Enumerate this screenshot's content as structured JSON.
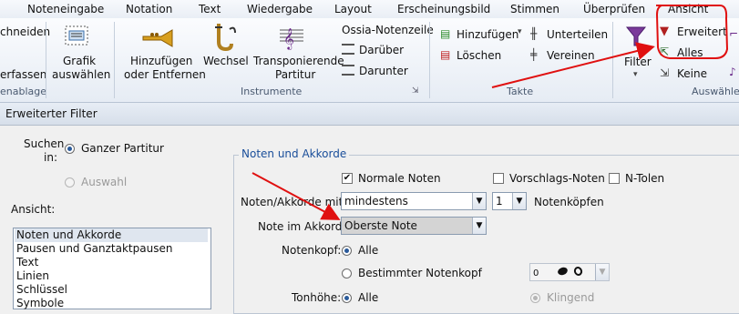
{
  "tabs": [
    "Noteneingabe",
    "Notation",
    "Text",
    "Wiedergabe",
    "Layout",
    "Erscheinungsbild",
    "Stimmen",
    "Überprüfen",
    "Ansicht"
  ],
  "ribbon": {
    "clipboard": {
      "item1": "chneiden",
      "item2": "erfassen",
      "group": "enablage"
    },
    "grafik": {
      "line1": "Grafik",
      "line2": "auswählen"
    },
    "instrumente": {
      "add_line1": "Hinzufügen",
      "add_line2": "oder Entfernen",
      "wechsel": "Wechsel",
      "transp_line1": "Transponierende",
      "transp_line2": "Partitur",
      "ossia": "Ossia-Notenzeile",
      "darueber": "Darüber",
      "darunter": "Darunter",
      "group": "Instrumente"
    },
    "takte": {
      "hinzufuegen": "Hinzufügen",
      "unterteilen": "Unterteilen",
      "loeschen": "Löschen",
      "vereinen": "Vereinen",
      "group": "Takte"
    },
    "filter": {
      "label": "Filter",
      "erweitert": "Erweitert",
      "alles": "Alles",
      "keine": "Keine",
      "group": "Auswähle"
    }
  },
  "dialog": {
    "title": "Erweiterter Filter",
    "suchen_label_1": "Suchen",
    "suchen_label_2": "in:",
    "opt_ganzer": "Ganzer Partitur",
    "opt_auswahl": "Auswahl",
    "ansicht_label": "Ansicht:",
    "list_items": [
      "Noten und Akkorde",
      "Pausen und Ganztaktpausen",
      "Text",
      "Linien",
      "Schlüssel",
      "Symbole"
    ],
    "section_title": "Noten und Akkorde",
    "chk_normale": "Normale Noten",
    "chk_vorschlag": "Vorschlags-Noten",
    "chk_ntolen": "N-Tolen",
    "mit_label": "Noten/Akkorde mit",
    "mit_value": "mindestens",
    "mit_count": "1",
    "notenkoepfen": "Notenköpfen",
    "akkord_label": "Note im Akkord:",
    "akkord_value": "Oberste Note",
    "kopf_label": "Notenkopf:",
    "kopf_alle": "Alle",
    "kopf_bestimmt": "Bestimmter Notenkopf",
    "kopf_select_value": "0",
    "hoehe_label": "Tonhöhe:",
    "hoehe_alle": "Alle",
    "klingend": "Klingend"
  },
  "colors": {
    "annotation_red": "#e01010",
    "accent_blue": "#2a5a9a"
  }
}
